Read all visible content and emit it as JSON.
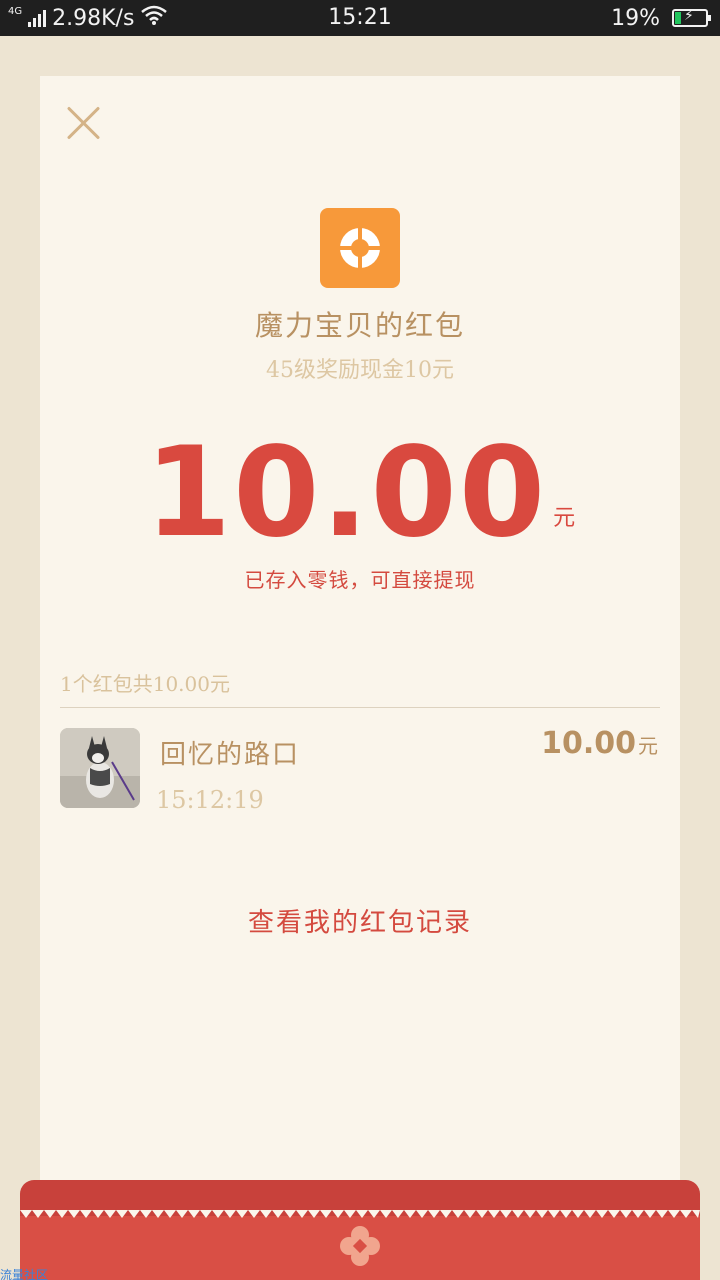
{
  "status_bar": {
    "network_type": "4G",
    "speed": "2.98K/s",
    "time": "15:21",
    "battery_percent": "19%",
    "battery_level": 0.19
  },
  "red_packet": {
    "sender_title": "魔力宝贝的红包",
    "subtitle": "45级奖励现金10元",
    "amount": "10.00",
    "amount_unit": "元",
    "deposit_note": "已存入零钱，可直接提现",
    "summary": "1个红包共10.00元"
  },
  "records": [
    {
      "name": "回忆的路口",
      "time": "15:12:19",
      "amount": "10.00",
      "unit": "元",
      "avatar_icon": "husky-dog-photo"
    }
  ],
  "history_link": "查看我的红包记录",
  "watermark": "流量社区",
  "colors": {
    "accent_red": "#d9493f",
    "gold_text": "#b89162",
    "logo_orange": "#f7993a",
    "card_bg": "#faf5eb",
    "page_bg": "#ede4d2"
  },
  "icons": {
    "close": "close-icon",
    "app_logo": "app-logo-icon",
    "footer_emblem": "flower-emblem-icon"
  }
}
